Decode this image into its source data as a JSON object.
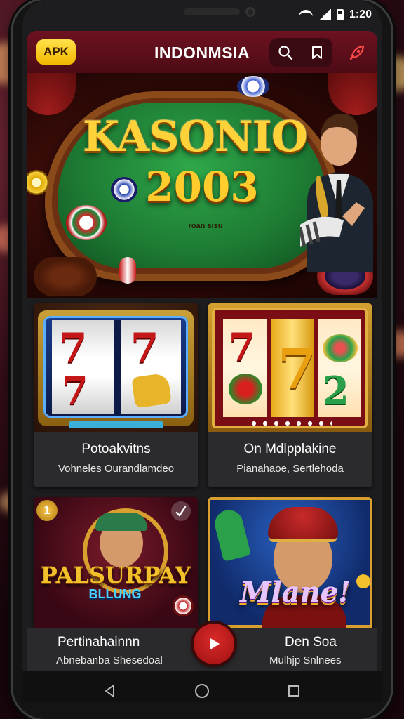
{
  "status_bar": {
    "time": "1:20"
  },
  "header": {
    "apk_label": "APK",
    "title": "INDONMSIA"
  },
  "hero": {
    "title": "KASONIO",
    "year": "2003",
    "subtitle": "roan sisu"
  },
  "games": [
    {
      "title": "Potoakvitns",
      "subtitle": "Vohneles Ourandlamdeo"
    },
    {
      "title": "On Mdlpplakine",
      "subtitle": "Pianahaoe, Sertlehoda"
    },
    {
      "title": "Pertinahainnn",
      "subtitle": "Abnebanba Shesedoal",
      "badge": "1",
      "thumb_text": "PALSURPAY",
      "thumb_subtext": "BLLUNG"
    },
    {
      "title": "Den Soa",
      "subtitle": "Mulhjp Snlnees",
      "thumb_text": "Mlane!"
    }
  ],
  "icons": {
    "apk": "apk-badge",
    "search": "search-icon",
    "bookmark": "bookmark-icon",
    "rocket": "rocket-icon",
    "play": "play-icon",
    "back": "back-icon",
    "home": "home-icon",
    "recents": "recents-icon"
  },
  "colors": {
    "header_bg": "#5e0e1a",
    "apk_badge": "#f7c41a",
    "card_bg": "#2b2b2d",
    "play_button": "#c01818"
  }
}
